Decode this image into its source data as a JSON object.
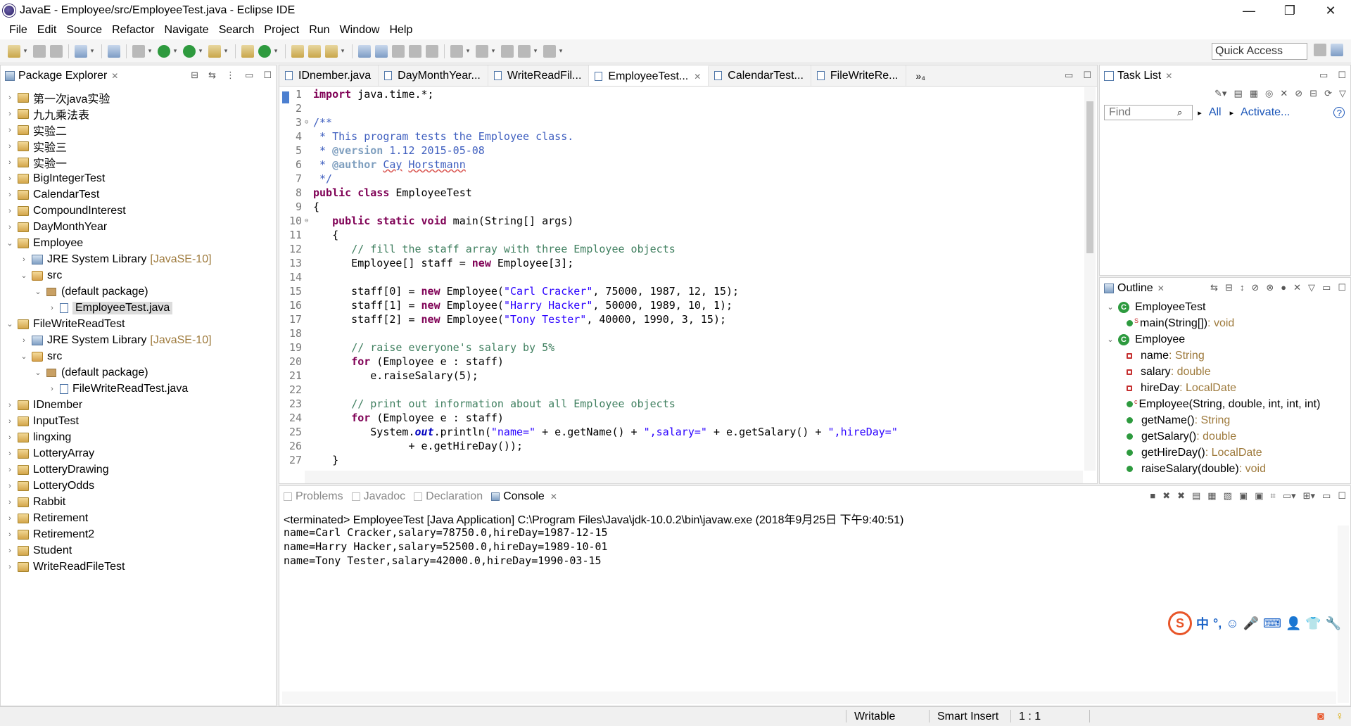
{
  "window": {
    "title": "JavaE - Employee/src/EmployeeTest.java - Eclipse IDE",
    "minimize": "—",
    "restore": "❐",
    "close": "✕"
  },
  "menu": [
    "File",
    "Edit",
    "Source",
    "Refactor",
    "Navigate",
    "Search",
    "Project",
    "Run",
    "Window",
    "Help"
  ],
  "toolbar": {
    "quick_access": "Quick Access"
  },
  "package_explorer": {
    "title": "Package Explorer",
    "items": [
      {
        "label": "第一次java实验",
        "suffix": "",
        "depth": 0,
        "twisty": "›",
        "icon": "project-icon"
      },
      {
        "label": "九九乘法表",
        "suffix": "",
        "depth": 0,
        "twisty": "›",
        "icon": "project-icon"
      },
      {
        "label": "实验二",
        "suffix": "",
        "depth": 0,
        "twisty": "›",
        "icon": "project-icon"
      },
      {
        "label": "实验三",
        "suffix": "",
        "depth": 0,
        "twisty": "›",
        "icon": "project-icon"
      },
      {
        "label": "实验一",
        "suffix": "",
        "depth": 0,
        "twisty": "›",
        "icon": "project-icon"
      },
      {
        "label": "BigIntegerTest",
        "suffix": "",
        "depth": 0,
        "twisty": "›",
        "icon": "project-icon"
      },
      {
        "label": "CalendarTest",
        "suffix": "",
        "depth": 0,
        "twisty": "›",
        "icon": "project-icon"
      },
      {
        "label": "CompoundInterest",
        "suffix": "",
        "depth": 0,
        "twisty": "›",
        "icon": "project-icon"
      },
      {
        "label": "DayMonthYear",
        "suffix": "",
        "depth": 0,
        "twisty": "›",
        "icon": "project-icon"
      },
      {
        "label": "Employee",
        "suffix": "",
        "depth": 0,
        "twisty": "⌄",
        "icon": "project-icon"
      },
      {
        "label": "JRE System Library",
        "suffix": "[JavaSE-10]",
        "depth": 1,
        "twisty": "›",
        "icon": "library-icon"
      },
      {
        "label": "src",
        "suffix": "",
        "depth": 1,
        "twisty": "⌄",
        "icon": "source-folder-icon"
      },
      {
        "label": "(default package)",
        "suffix": "",
        "depth": 2,
        "twisty": "⌄",
        "icon": "package-icon"
      },
      {
        "label": "EmployeeTest.java",
        "suffix": "",
        "depth": 3,
        "twisty": "›",
        "icon": "java-file-icon",
        "selected": true
      },
      {
        "label": "FileWriteReadTest",
        "suffix": "",
        "depth": 0,
        "twisty": "⌄",
        "icon": "project-icon"
      },
      {
        "label": "JRE System Library",
        "suffix": "[JavaSE-10]",
        "depth": 1,
        "twisty": "›",
        "icon": "library-icon"
      },
      {
        "label": "src",
        "suffix": "",
        "depth": 1,
        "twisty": "⌄",
        "icon": "source-folder-icon"
      },
      {
        "label": "(default package)",
        "suffix": "",
        "depth": 2,
        "twisty": "⌄",
        "icon": "package-icon"
      },
      {
        "label": "FileWriteReadTest.java",
        "suffix": "",
        "depth": 3,
        "twisty": "›",
        "icon": "java-file-icon"
      },
      {
        "label": "IDnember",
        "suffix": "",
        "depth": 0,
        "twisty": "›",
        "icon": "project-icon"
      },
      {
        "label": "InputTest",
        "suffix": "",
        "depth": 0,
        "twisty": "›",
        "icon": "project-icon"
      },
      {
        "label": "lingxing",
        "suffix": "",
        "depth": 0,
        "twisty": "›",
        "icon": "project-icon"
      },
      {
        "label": "LotteryArray",
        "suffix": "",
        "depth": 0,
        "twisty": "›",
        "icon": "project-icon"
      },
      {
        "label": "LotteryDrawing",
        "suffix": "",
        "depth": 0,
        "twisty": "›",
        "icon": "project-icon"
      },
      {
        "label": "LotteryOdds",
        "suffix": "",
        "depth": 0,
        "twisty": "›",
        "icon": "project-icon"
      },
      {
        "label": "Rabbit",
        "suffix": "",
        "depth": 0,
        "twisty": "›",
        "icon": "project-icon"
      },
      {
        "label": "Retirement",
        "suffix": "",
        "depth": 0,
        "twisty": "›",
        "icon": "project-icon"
      },
      {
        "label": "Retirement2",
        "suffix": "",
        "depth": 0,
        "twisty": "›",
        "icon": "project-icon"
      },
      {
        "label": "Student",
        "suffix": "",
        "depth": 0,
        "twisty": "›",
        "icon": "project-icon"
      },
      {
        "label": "WriteReadFileTest",
        "suffix": "",
        "depth": 0,
        "twisty": "›",
        "icon": "project-icon"
      }
    ]
  },
  "editor": {
    "tabs": [
      {
        "label": "IDnember.java",
        "active": false
      },
      {
        "label": "DayMonthYear...",
        "active": false
      },
      {
        "label": "WriteReadFil...",
        "active": false
      },
      {
        "label": "EmployeeTest...",
        "active": true
      },
      {
        "label": "CalendarTest...",
        "active": false
      },
      {
        "label": "FileWriteRe...",
        "active": false
      }
    ],
    "overflow": "»₄",
    "lines": [
      {
        "n": "1",
        "fold": "",
        "spans": [
          [
            "kw",
            "import"
          ],
          [
            "",
            " java.time.*;"
          ]
        ]
      },
      {
        "n": "2",
        "fold": "",
        "spans": []
      },
      {
        "n": "3",
        "fold": "⊖",
        "spans": [
          [
            "jd",
            "/**"
          ]
        ]
      },
      {
        "n": "4",
        "fold": "",
        "spans": [
          [
            "jd",
            " * This program tests the Employee class."
          ]
        ]
      },
      {
        "n": "5",
        "fold": "",
        "spans": [
          [
            "jd",
            " * "
          ],
          [
            "jt",
            "@version"
          ],
          [
            "jd",
            " 1.12 2015-05-08"
          ]
        ]
      },
      {
        "n": "6",
        "fold": "",
        "spans": [
          [
            "jd",
            " * "
          ],
          [
            "jt",
            "@author"
          ],
          [
            "jd",
            " "
          ],
          [
            "jd sq",
            "Cay"
          ],
          [
            "jd",
            " "
          ],
          [
            "jd sq",
            "Horstmann"
          ]
        ]
      },
      {
        "n": "7",
        "fold": "",
        "spans": [
          [
            "jd",
            " */"
          ]
        ]
      },
      {
        "n": "8",
        "fold": "",
        "spans": [
          [
            "kw",
            "public class"
          ],
          [
            "",
            " EmployeeTest"
          ]
        ]
      },
      {
        "n": "9",
        "fold": "",
        "spans": [
          [
            "",
            "{"
          ]
        ]
      },
      {
        "n": "10",
        "fold": "⊖",
        "spans": [
          [
            "",
            "   "
          ],
          [
            "kw",
            "public static void"
          ],
          [
            "",
            " main(String[] args)"
          ]
        ]
      },
      {
        "n": "11",
        "fold": "",
        "spans": [
          [
            "",
            "   {"
          ]
        ]
      },
      {
        "n": "12",
        "fold": "",
        "spans": [
          [
            "",
            "      "
          ],
          [
            "cm",
            "// fill the staff array with three Employee objects"
          ]
        ]
      },
      {
        "n": "13",
        "fold": "",
        "spans": [
          [
            "",
            "      Employee[] staff = "
          ],
          [
            "kw",
            "new"
          ],
          [
            "",
            " Employee[3];"
          ]
        ]
      },
      {
        "n": "14",
        "fold": "",
        "spans": []
      },
      {
        "n": "15",
        "fold": "",
        "spans": [
          [
            "",
            "      staff[0] = "
          ],
          [
            "kw",
            "new"
          ],
          [
            "",
            " Employee("
          ],
          [
            "st",
            "\"Carl Cracker\""
          ],
          [
            "",
            ", 75000, 1987, 12, 15);"
          ]
        ]
      },
      {
        "n": "16",
        "fold": "",
        "spans": [
          [
            "",
            "      staff[1] = "
          ],
          [
            "kw",
            "new"
          ],
          [
            "",
            " Employee("
          ],
          [
            "st",
            "\"Harry Hacker\""
          ],
          [
            "",
            ", 50000, 1989, 10, 1);"
          ]
        ]
      },
      {
        "n": "17",
        "fold": "",
        "spans": [
          [
            "",
            "      staff[2] = "
          ],
          [
            "kw",
            "new"
          ],
          [
            "",
            " Employee("
          ],
          [
            "st",
            "\"Tony Tester\""
          ],
          [
            "",
            ", 40000, 1990, 3, 15);"
          ]
        ]
      },
      {
        "n": "18",
        "fold": "",
        "spans": []
      },
      {
        "n": "19",
        "fold": "",
        "spans": [
          [
            "",
            "      "
          ],
          [
            "cm",
            "// raise everyone's salary by 5%"
          ]
        ]
      },
      {
        "n": "20",
        "fold": "",
        "spans": [
          [
            "",
            "      "
          ],
          [
            "kw",
            "for"
          ],
          [
            "",
            " (Employee e : staff)"
          ]
        ]
      },
      {
        "n": "21",
        "fold": "",
        "spans": [
          [
            "",
            "         e.raiseSalary(5);"
          ]
        ]
      },
      {
        "n": "22",
        "fold": "",
        "spans": []
      },
      {
        "n": "23",
        "fold": "",
        "spans": [
          [
            "",
            "      "
          ],
          [
            "cm",
            "// print out information about all Employee objects"
          ]
        ]
      },
      {
        "n": "24",
        "fold": "",
        "spans": [
          [
            "",
            "      "
          ],
          [
            "kw",
            "for"
          ],
          [
            "",
            " (Employee e : staff)"
          ]
        ]
      },
      {
        "n": "25",
        "fold": "",
        "spans": [
          [
            "",
            "         System."
          ],
          [
            "fi",
            "out"
          ],
          [
            "",
            ".println("
          ],
          [
            "st",
            "\"name=\""
          ],
          [
            "",
            " + e.getName() + "
          ],
          [
            "st",
            "\",salary=\""
          ],
          [
            "",
            " + e.getSalary() + "
          ],
          [
            "st",
            "\",hireDay=\""
          ]
        ]
      },
      {
        "n": "26",
        "fold": "",
        "spans": [
          [
            "",
            "               + e.getHireDay());"
          ]
        ]
      },
      {
        "n": "27",
        "fold": "",
        "spans": [
          [
            "",
            "   }"
          ]
        ]
      }
    ]
  },
  "task_list": {
    "title": "Task List",
    "find_placeholder": "Find",
    "all": "All",
    "activate": "Activate...",
    "help": "?"
  },
  "outline": {
    "title": "Outline",
    "items": [
      {
        "depth": 0,
        "kind": "class",
        "twisty": "⌄",
        "name": "EmployeeTest",
        "type": "",
        "sup": ""
      },
      {
        "depth": 1,
        "kind": "pub",
        "twisty": "",
        "name": "main(String[])",
        "type": " : void",
        "sup": "S"
      },
      {
        "depth": 0,
        "kind": "class",
        "twisty": "⌄",
        "name": "Employee",
        "type": "",
        "sup": ""
      },
      {
        "depth": 1,
        "kind": "priv",
        "twisty": "",
        "name": "name",
        "type": " : String",
        "sup": ""
      },
      {
        "depth": 1,
        "kind": "priv",
        "twisty": "",
        "name": "salary",
        "type": " : double",
        "sup": ""
      },
      {
        "depth": 1,
        "kind": "priv",
        "twisty": "",
        "name": "hireDay",
        "type": " : LocalDate",
        "sup": ""
      },
      {
        "depth": 1,
        "kind": "pub",
        "twisty": "",
        "name": "Employee(String, double, int, int, int)",
        "type": "",
        "sup": "c"
      },
      {
        "depth": 1,
        "kind": "pub",
        "twisty": "",
        "name": "getName()",
        "type": " : String",
        "sup": ""
      },
      {
        "depth": 1,
        "kind": "pub",
        "twisty": "",
        "name": "getSalary()",
        "type": " : double",
        "sup": ""
      },
      {
        "depth": 1,
        "kind": "pub",
        "twisty": "",
        "name": "getHireDay()",
        "type": " : LocalDate",
        "sup": ""
      },
      {
        "depth": 1,
        "kind": "pub",
        "twisty": "",
        "name": "raiseSalary(double)",
        "type": " : void",
        "sup": ""
      }
    ]
  },
  "console": {
    "tabs": [
      {
        "label": "Problems",
        "active": false,
        "icon": "problems-icon"
      },
      {
        "label": "Javadoc",
        "active": false,
        "icon": "javadoc-icon"
      },
      {
        "label": "Declaration",
        "active": false,
        "icon": "declaration-icon"
      },
      {
        "label": "Console",
        "active": true,
        "icon": "console-icon"
      }
    ],
    "terminated": "<terminated> EmployeeTest [Java Application] C:\\Program Files\\Java\\jdk-10.0.2\\bin\\javaw.exe (2018年9月25日 下午9:40:51)",
    "output": [
      "name=Carl Cracker,salary=78750.0,hireDay=1987-12-15",
      "name=Harry Hacker,salary=52500.0,hireDay=1989-10-01",
      "name=Tony Tester,salary=42000.0,hireDay=1990-03-15"
    ]
  },
  "ime": {
    "logo": "S",
    "lang": "中",
    "punct": "°,",
    "smile": "☺",
    "mic": "🎤",
    "keyboard": "⌨",
    "user": "👤",
    "shirt": "👕",
    "wrench": "🔧"
  },
  "status": {
    "writable": "Writable",
    "insert_mode": "Smart Insert",
    "position": "1 : 1"
  },
  "colors": {
    "keyword": "#7f0055",
    "comment": "#3f7f5f",
    "javadoc": "#3f5fbf",
    "string": "#2a00ff",
    "link": "#1a55b8",
    "selection": "#dcdcdc"
  }
}
